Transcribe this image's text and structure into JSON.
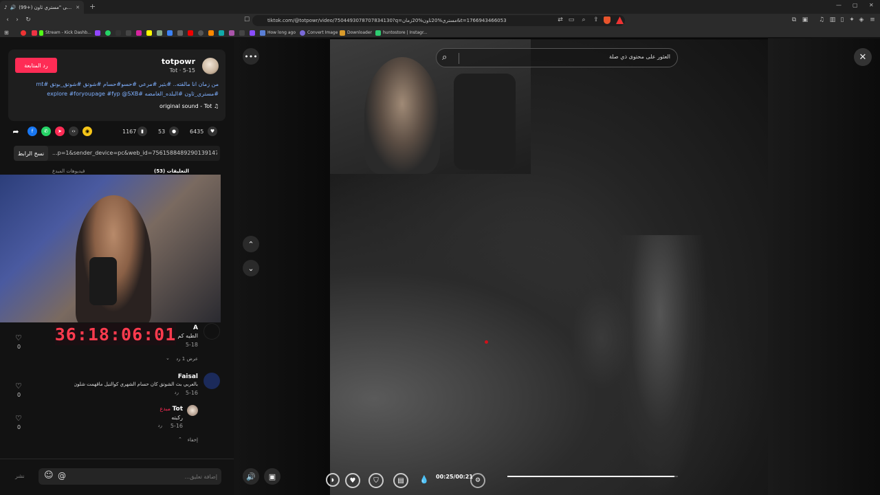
{
  "browser": {
    "tab_title": "(99+) الرد على \"مستري ثاون\" | Tot...",
    "tab_close": "✕",
    "new_tab": "+",
    "url": "tiktok.com/@totpowr/video/7504493078707834130?q=مستري%20ثاون%20زمان&t=1766943466053",
    "window_controls": [
      "—",
      "▢",
      "✕"
    ]
  },
  "bookmarks": [
    {
      "label": "",
      "color": "#e33"
    },
    {
      "label": "Stream - Kick Dashb...",
      "color": "#53fc18"
    },
    {
      "label": "How long ago",
      "color": "#5a7fd6"
    },
    {
      "label": "Convert Image",
      "color": "#7a6ad8"
    },
    {
      "label": "Downloader",
      "color": "#d99b2b"
    },
    {
      "label": "huntostore | Instagr...",
      "color": "#2ecc71"
    }
  ],
  "post": {
    "username": "totpowr",
    "subline": "Tot · 5-15",
    "follow_label": "رد المتابعة",
    "caption_line1": "من زمان انا مالقته.. #بثير #مرعي #حسو#حسام #شوتق #شوتق_بوتق #mt",
    "caption_line2": "#مستري_ثاون #البلده_الغامضه #explore #foryoupage #fyp @SXB",
    "sound": "♫ original sound - Tot",
    "likes": "6435",
    "comments": "53",
    "saves": "1167",
    "link_text": "...p=1&sender_device=pc&web_id=7561588489290139147",
    "copy_link_label": "نسخ الرابط",
    "tab_comments": "التعليقات (53)",
    "tab_creator_videos": "فيديوهات المبدع"
  },
  "overlay_timer": "36:18:06:01",
  "comments": [
    {
      "name": "A",
      "text": "الطيه كم",
      "date": "5-18",
      "reply": "رد",
      "likes": "0",
      "view_replies": "عرض 1 رد"
    },
    {
      "name": "Faisal",
      "text": "بالعربي بث الشوتق كان حسام الشهري كوالتيل ماقهمت شلون؟",
      "date": "5-16",
      "reply": "رد",
      "likes": "0"
    },
    {
      "name": "Tot",
      "badge": "مبدع",
      "text": "ركبته",
      "date": "5-16",
      "reply": "رد",
      "likes": "0",
      "hide": "إخفاء"
    }
  ],
  "comment_input": {
    "placeholder": "إضافة تعليق...",
    "post_label": "نشر"
  },
  "video": {
    "search_placeholder": "العثور على محتوى ذي صلة",
    "time": "00:25/00:21",
    "progress": 0.98
  },
  "colors": {
    "accent": "#fe2c55",
    "link": "#7fb0ff",
    "timer": "#ff3b4e"
  }
}
